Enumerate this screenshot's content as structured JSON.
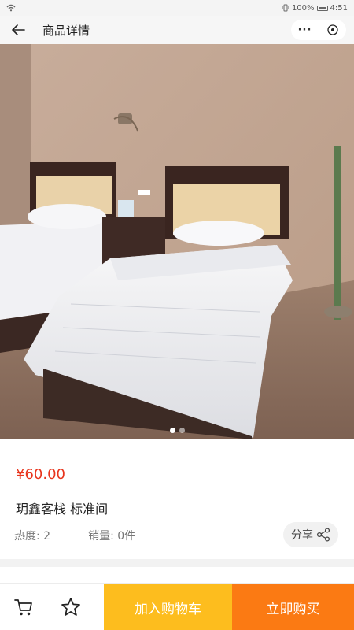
{
  "status_bar": {
    "battery": "100%",
    "time": "4:51"
  },
  "nav": {
    "title": "商品详情",
    "more_label": "···"
  },
  "gallery": {
    "image_count": 2,
    "active_index": 0
  },
  "product": {
    "price": "¥60.00",
    "name": "玥鑫客栈  标准间",
    "heat": "热度: 2",
    "sales": "销量: 0件",
    "share_label": "分享"
  },
  "bottom": {
    "add_cart_label": "加入购物车",
    "buy_label": "立即购买"
  },
  "colors": {
    "price": "#e8341c",
    "add_cart_bg": "#fdbd1e",
    "buy_bg": "#fb7a13"
  }
}
